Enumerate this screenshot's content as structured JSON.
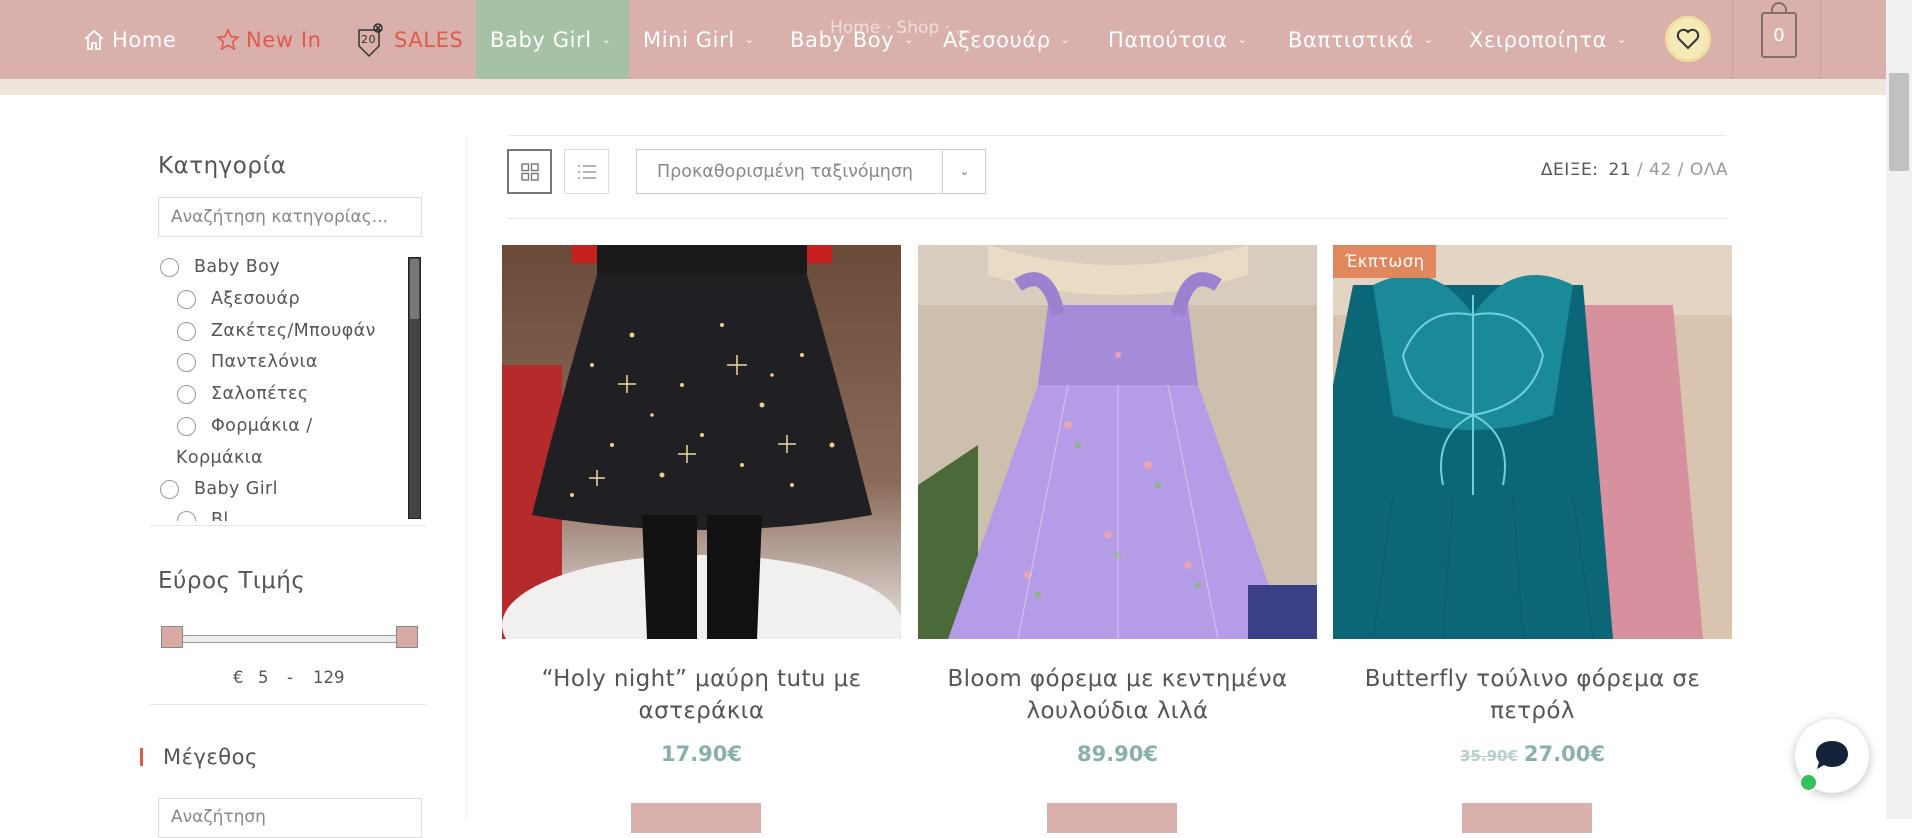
{
  "nav": {
    "breadcrumb": "Home · Shop · ...",
    "items": [
      {
        "label": "Home",
        "icon": "home-icon"
      },
      {
        "label": "New In",
        "icon": "star-icon"
      },
      {
        "label": "SALES",
        "icon": "sale-tag-icon",
        "badge": "20"
      },
      {
        "label": "Baby Girl"
      },
      {
        "label": "Mini Girl"
      },
      {
        "label": "Baby Boy"
      },
      {
        "label": "Αξεσουάρ"
      },
      {
        "label": "Παπούτσια"
      },
      {
        "label": "Βαπτιστικά"
      },
      {
        "label": "Χειροποίητα"
      }
    ],
    "cart_count": "0",
    "colors": {
      "bar": "#d9b0ac",
      "active": "#a5c2a6",
      "accent_red": "#e05a4a"
    }
  },
  "sidebar": {
    "category_title": "Κατηγορία",
    "category_search_placeholder": "Αναζήτηση κατηγορίας...",
    "categories": [
      {
        "label": "Baby Boy",
        "level": 0
      },
      {
        "label": "Αξεσουάρ",
        "level": 1
      },
      {
        "label": "Ζακέτες/Μπουφάν",
        "level": 1
      },
      {
        "label": "Παντελόνια",
        "level": 1
      },
      {
        "label": "Σαλοπέτες",
        "level": 1
      },
      {
        "label": "Φορμάκια /",
        "label2": "Κορμάκια",
        "level": 1
      },
      {
        "label": "Baby Girl",
        "level": 0
      },
      {
        "label": "Bl...",
        "level": 1
      }
    ],
    "price_title": "Εύρος Τιμής",
    "price_currency": "€",
    "price_min": "5",
    "price_sep": "-",
    "price_max": "129",
    "size_title": "Μέγεθος",
    "size_search_placeholder": "Αναζήτηση"
  },
  "toolbar": {
    "sort_label": "Προκαθορισμένη ταξινόμηση",
    "show_label": "ΔΕΙΞΕ:",
    "show_options": [
      "21",
      "42",
      "ΟΛΑ"
    ],
    "show_sep": "/"
  },
  "products": [
    {
      "name_line1": "“Holy night” μαύρη tutu με",
      "name_line2": "αστεράκια",
      "price": "17.90€"
    },
    {
      "name_line1": "Bloom φόρεμα με κεντημένα",
      "name_line2": "λουλούδια λιλά",
      "price": "89.90€"
    },
    {
      "name_line1": "Butterfly τούλινο φόρεμα σε",
      "name_line2": "πετρόλ",
      "old_price": "35.90€",
      "price": "27.00€",
      "badge": "Έκπτωση"
    }
  ]
}
